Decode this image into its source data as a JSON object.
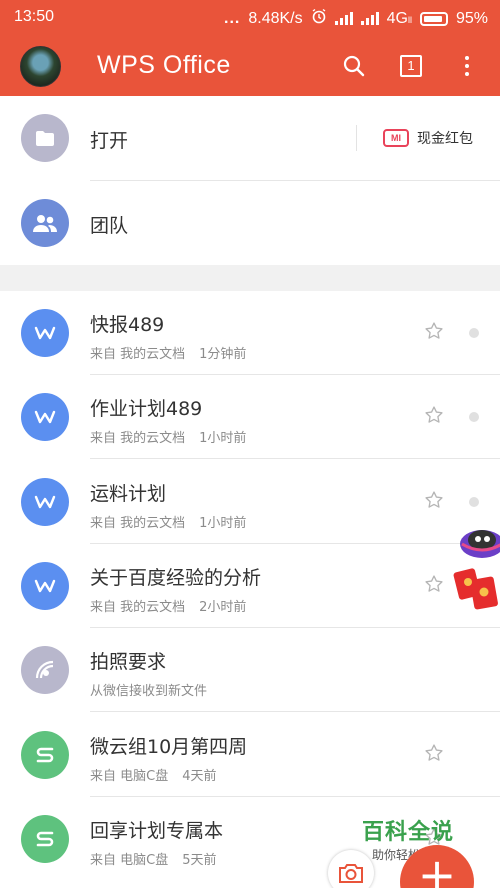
{
  "status_bar": {
    "time": "13:50",
    "dots": "...",
    "speed": "8.48K/s",
    "network": "4G",
    "network_sub": "ll",
    "battery": "95%"
  },
  "app_bar": {
    "title": "WPS Office",
    "tab_count": "1",
    "icons": [
      "search-icon",
      "tabs-icon",
      "more-icon"
    ],
    "color": "#e9543a"
  },
  "quick_actions": [
    {
      "label": "打开",
      "icon": "folder-icon",
      "color": "#b8b7cc"
    },
    {
      "label": "团队",
      "icon": "team-icon",
      "color": "#6e8cd8"
    }
  ],
  "promo": {
    "label": "现金红包",
    "badge": "MI"
  },
  "files": [
    {
      "name": "快报489",
      "source": "来自 我的云文档",
      "time": "1分钟前",
      "icon": "wps-doc-icon",
      "color": "#5b8ff0"
    },
    {
      "name": "作业计划489",
      "source": "来自 我的云文档",
      "time": "1小时前",
      "icon": "wps-doc-icon",
      "color": "#5b8ff0"
    },
    {
      "name": "运料计划",
      "source": "来自 我的云文档",
      "time": "1小时前",
      "icon": "wps-doc-icon",
      "color": "#5b8ff0"
    },
    {
      "name": "关于百度经验的分析",
      "source": "来自 我的云文档",
      "time": "2小时前",
      "icon": "wps-doc-icon",
      "color": "#5b8ff0"
    },
    {
      "name": "拍照要求",
      "source": "从微信接收到新文件",
      "time": "",
      "icon": "wechat-receive-icon",
      "color": "#b8b7cc"
    },
    {
      "name": "微云组10月第四周",
      "source": "来自 电脑C盘",
      "time": "4天前",
      "icon": "wps-sheet-icon",
      "color": "#5ec27e"
    },
    {
      "name": "回享计划专属本",
      "source": "来自 电脑C盘",
      "time": "5天前",
      "icon": "wps-sheet-icon",
      "color": "#5ec27e"
    }
  ],
  "watermark": {
    "title": "百科全说",
    "subtitle": "助你轻松解决"
  },
  "fab": {
    "label": "+"
  }
}
